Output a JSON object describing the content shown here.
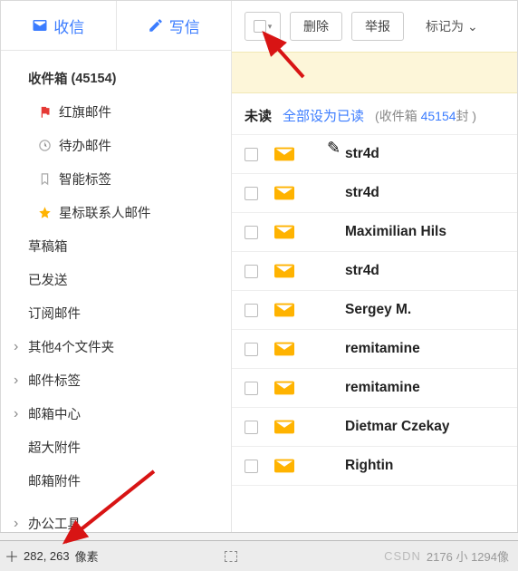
{
  "sidebar": {
    "top": {
      "receive": "收信",
      "compose": "写信"
    },
    "inbox_label": "收件箱",
    "inbox_count": "(45154)",
    "items": [
      {
        "label": "红旗邮件",
        "icon": "flag"
      },
      {
        "label": "待办邮件",
        "icon": "clock"
      },
      {
        "label": "智能标签",
        "icon": "bookmark"
      },
      {
        "label": "星标联系人邮件",
        "icon": "star"
      }
    ],
    "plain": [
      "草稿箱",
      "已发送",
      "订阅邮件"
    ],
    "expand": [
      "其他4个文件夹",
      "邮件标签",
      "邮箱中心"
    ],
    "tail": [
      "超大附件",
      "邮箱附件"
    ],
    "office": "办公工具"
  },
  "toolbar": {
    "delete": "删除",
    "report": "举报",
    "markas": "标记为",
    "caret": "⌄"
  },
  "filter": {
    "unread": "未读",
    "markall": "全部设为已读",
    "hint_prefix": "(收件箱 ",
    "hint_num": "45154",
    "hint_suffix": "封  )"
  },
  "senders": [
    "str4d",
    "str4d",
    "Maximilian Hils",
    "str4d",
    "Sergey M.",
    "remitamine",
    "remitamine",
    "Dietmar Czekay",
    "Rightin"
  ],
  "status": {
    "coords": "282, 263",
    "coords_suffix": "像素",
    "wm": "CSDN",
    "right": "2176 小 1294像"
  }
}
